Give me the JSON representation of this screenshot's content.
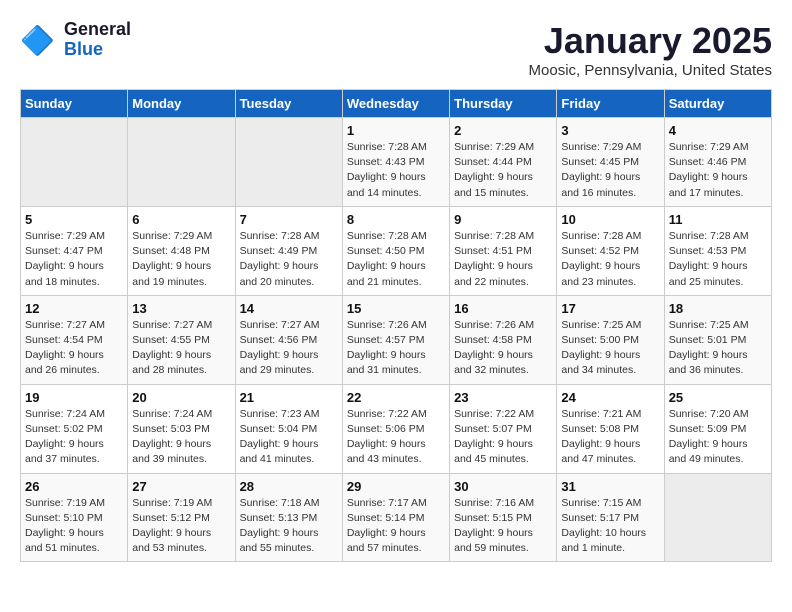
{
  "header": {
    "logo_general": "General",
    "logo_blue": "Blue",
    "month_title": "January 2025",
    "location": "Moosic, Pennsylvania, United States"
  },
  "weekdays": [
    "Sunday",
    "Monday",
    "Tuesday",
    "Wednesday",
    "Thursday",
    "Friday",
    "Saturday"
  ],
  "weeks": [
    [
      {
        "day": "",
        "sunrise": "",
        "sunset": "",
        "daylight": ""
      },
      {
        "day": "",
        "sunrise": "",
        "sunset": "",
        "daylight": ""
      },
      {
        "day": "",
        "sunrise": "",
        "sunset": "",
        "daylight": ""
      },
      {
        "day": "1",
        "sunrise": "Sunrise: 7:28 AM",
        "sunset": "Sunset: 4:43 PM",
        "daylight": "Daylight: 9 hours and 14 minutes."
      },
      {
        "day": "2",
        "sunrise": "Sunrise: 7:29 AM",
        "sunset": "Sunset: 4:44 PM",
        "daylight": "Daylight: 9 hours and 15 minutes."
      },
      {
        "day": "3",
        "sunrise": "Sunrise: 7:29 AM",
        "sunset": "Sunset: 4:45 PM",
        "daylight": "Daylight: 9 hours and 16 minutes."
      },
      {
        "day": "4",
        "sunrise": "Sunrise: 7:29 AM",
        "sunset": "Sunset: 4:46 PM",
        "daylight": "Daylight: 9 hours and 17 minutes."
      }
    ],
    [
      {
        "day": "5",
        "sunrise": "Sunrise: 7:29 AM",
        "sunset": "Sunset: 4:47 PM",
        "daylight": "Daylight: 9 hours and 18 minutes."
      },
      {
        "day": "6",
        "sunrise": "Sunrise: 7:29 AM",
        "sunset": "Sunset: 4:48 PM",
        "daylight": "Daylight: 9 hours and 19 minutes."
      },
      {
        "day": "7",
        "sunrise": "Sunrise: 7:28 AM",
        "sunset": "Sunset: 4:49 PM",
        "daylight": "Daylight: 9 hours and 20 minutes."
      },
      {
        "day": "8",
        "sunrise": "Sunrise: 7:28 AM",
        "sunset": "Sunset: 4:50 PM",
        "daylight": "Daylight: 9 hours and 21 minutes."
      },
      {
        "day": "9",
        "sunrise": "Sunrise: 7:28 AM",
        "sunset": "Sunset: 4:51 PM",
        "daylight": "Daylight: 9 hours and 22 minutes."
      },
      {
        "day": "10",
        "sunrise": "Sunrise: 7:28 AM",
        "sunset": "Sunset: 4:52 PM",
        "daylight": "Daylight: 9 hours and 23 minutes."
      },
      {
        "day": "11",
        "sunrise": "Sunrise: 7:28 AM",
        "sunset": "Sunset: 4:53 PM",
        "daylight": "Daylight: 9 hours and 25 minutes."
      }
    ],
    [
      {
        "day": "12",
        "sunrise": "Sunrise: 7:27 AM",
        "sunset": "Sunset: 4:54 PM",
        "daylight": "Daylight: 9 hours and 26 minutes."
      },
      {
        "day": "13",
        "sunrise": "Sunrise: 7:27 AM",
        "sunset": "Sunset: 4:55 PM",
        "daylight": "Daylight: 9 hours and 28 minutes."
      },
      {
        "day": "14",
        "sunrise": "Sunrise: 7:27 AM",
        "sunset": "Sunset: 4:56 PM",
        "daylight": "Daylight: 9 hours and 29 minutes."
      },
      {
        "day": "15",
        "sunrise": "Sunrise: 7:26 AM",
        "sunset": "Sunset: 4:57 PM",
        "daylight": "Daylight: 9 hours and 31 minutes."
      },
      {
        "day": "16",
        "sunrise": "Sunrise: 7:26 AM",
        "sunset": "Sunset: 4:58 PM",
        "daylight": "Daylight: 9 hours and 32 minutes."
      },
      {
        "day": "17",
        "sunrise": "Sunrise: 7:25 AM",
        "sunset": "Sunset: 5:00 PM",
        "daylight": "Daylight: 9 hours and 34 minutes."
      },
      {
        "day": "18",
        "sunrise": "Sunrise: 7:25 AM",
        "sunset": "Sunset: 5:01 PM",
        "daylight": "Daylight: 9 hours and 36 minutes."
      }
    ],
    [
      {
        "day": "19",
        "sunrise": "Sunrise: 7:24 AM",
        "sunset": "Sunset: 5:02 PM",
        "daylight": "Daylight: 9 hours and 37 minutes."
      },
      {
        "day": "20",
        "sunrise": "Sunrise: 7:24 AM",
        "sunset": "Sunset: 5:03 PM",
        "daylight": "Daylight: 9 hours and 39 minutes."
      },
      {
        "day": "21",
        "sunrise": "Sunrise: 7:23 AM",
        "sunset": "Sunset: 5:04 PM",
        "daylight": "Daylight: 9 hours and 41 minutes."
      },
      {
        "day": "22",
        "sunrise": "Sunrise: 7:22 AM",
        "sunset": "Sunset: 5:06 PM",
        "daylight": "Daylight: 9 hours and 43 minutes."
      },
      {
        "day": "23",
        "sunrise": "Sunrise: 7:22 AM",
        "sunset": "Sunset: 5:07 PM",
        "daylight": "Daylight: 9 hours and 45 minutes."
      },
      {
        "day": "24",
        "sunrise": "Sunrise: 7:21 AM",
        "sunset": "Sunset: 5:08 PM",
        "daylight": "Daylight: 9 hours and 47 minutes."
      },
      {
        "day": "25",
        "sunrise": "Sunrise: 7:20 AM",
        "sunset": "Sunset: 5:09 PM",
        "daylight": "Daylight: 9 hours and 49 minutes."
      }
    ],
    [
      {
        "day": "26",
        "sunrise": "Sunrise: 7:19 AM",
        "sunset": "Sunset: 5:10 PM",
        "daylight": "Daylight: 9 hours and 51 minutes."
      },
      {
        "day": "27",
        "sunrise": "Sunrise: 7:19 AM",
        "sunset": "Sunset: 5:12 PM",
        "daylight": "Daylight: 9 hours and 53 minutes."
      },
      {
        "day": "28",
        "sunrise": "Sunrise: 7:18 AM",
        "sunset": "Sunset: 5:13 PM",
        "daylight": "Daylight: 9 hours and 55 minutes."
      },
      {
        "day": "29",
        "sunrise": "Sunrise: 7:17 AM",
        "sunset": "Sunset: 5:14 PM",
        "daylight": "Daylight: 9 hours and 57 minutes."
      },
      {
        "day": "30",
        "sunrise": "Sunrise: 7:16 AM",
        "sunset": "Sunset: 5:15 PM",
        "daylight": "Daylight: 9 hours and 59 minutes."
      },
      {
        "day": "31",
        "sunrise": "Sunrise: 7:15 AM",
        "sunset": "Sunset: 5:17 PM",
        "daylight": "Daylight: 10 hours and 1 minute."
      },
      {
        "day": "",
        "sunrise": "",
        "sunset": "",
        "daylight": ""
      }
    ]
  ]
}
